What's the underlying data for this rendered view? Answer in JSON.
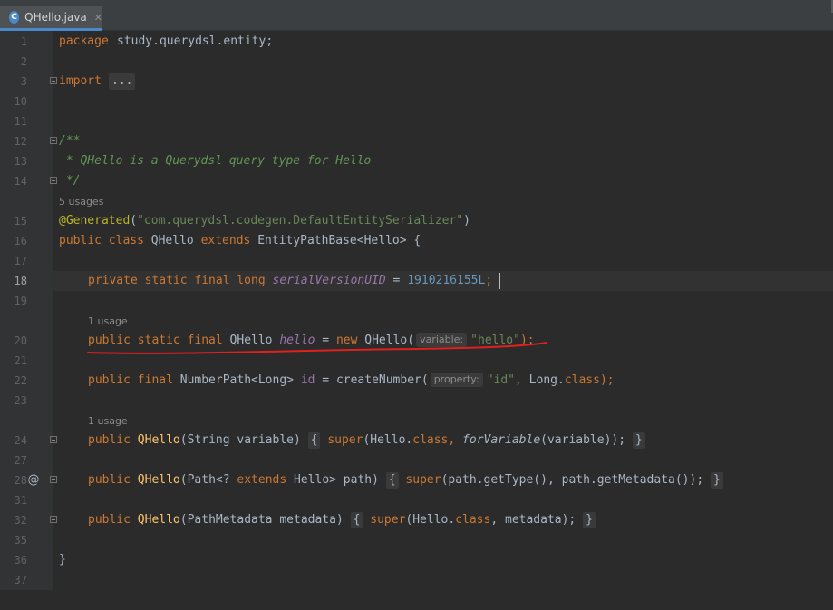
{
  "tab": {
    "filename": "QHello.java",
    "icon_letter": "C",
    "close_glyph": "✕"
  },
  "colors": {
    "keyword": "#cc7832",
    "string": "#6a8759",
    "number": "#6897bb",
    "annotation": "#bbb529",
    "comment": "#629755",
    "static_field": "#9876aa",
    "method_decl": "#ffc66d",
    "underline": "#e0201c"
  },
  "usages": {
    "class": "5 usages",
    "hello_field": "1 usage",
    "ctor1": "1 usage"
  },
  "lines": {
    "l1": {
      "num": "1",
      "package_kw": "package",
      "package_name": "study.querydsl.entity;"
    },
    "l2": {
      "num": "2"
    },
    "l3": {
      "num": "3",
      "import_kw": "import",
      "folded": "..."
    },
    "l10": {
      "num": "10"
    },
    "l11": {
      "num": "11"
    },
    "l12": {
      "num": "12",
      "text": "/**"
    },
    "l13": {
      "num": "13",
      "text": " * QHello is a Querydsl query type for Hello"
    },
    "l14": {
      "num": "14",
      "text": " */"
    },
    "l15": {
      "num": "15",
      "annotation": "@Generated",
      "open": "(",
      "value": "\"com.querydsl.codegen.DefaultEntitySerializer\"",
      "close": ")"
    },
    "l16": {
      "num": "16",
      "kw1": "public",
      "kw2": "class",
      "name": "QHello",
      "kw3": "extends",
      "base": "EntityPathBase<Hello> {"
    },
    "l17": {
      "num": "17"
    },
    "l18": {
      "num": "18",
      "kw": "private static final long",
      "field": "serialVersionUID",
      "eq": " = ",
      "value": "1910216155L",
      "semi": ";"
    },
    "l19": {
      "num": "19"
    },
    "l20": {
      "num": "20",
      "kw": "public static final",
      "type": "QHello",
      "field": "hello",
      "eq": " = ",
      "kw_new": "new",
      "call": "QHello(",
      "hint": "variable:",
      "value": "\"hello\"",
      "end": ");"
    },
    "l21": {
      "num": "21"
    },
    "l22": {
      "num": "22",
      "kw": "public final",
      "type": "NumberPath<Long>",
      "field": "id",
      "eq": " = createNumber(",
      "hint": "property:",
      "value": "\"id\"",
      "comma": ", ",
      "cls": "Long.",
      "cls_kw": "class",
      "end": ");"
    },
    "l23": {
      "num": "23"
    },
    "l24": {
      "num": "24",
      "kw": "public",
      "name": "QHello",
      "params": "(String variable)",
      "ob": "{",
      "super_kw": "super",
      "a1": "(Hello.",
      "class_kw": "class",
      "a2": ", ",
      "call": "forVariable",
      "a3": "(variable));",
      "cb": "}"
    },
    "l27": {
      "num": "27"
    },
    "l28": {
      "num": "28",
      "gutter_mark": "@",
      "kw": "public",
      "name": "QHello",
      "p1": "(Path<? ",
      "ext_kw": "extends",
      "p2": " Hello> path)",
      "ob": "{",
      "super_kw": "super",
      "a1": "(path.getType(), path.getMetadata());",
      "cb": "}"
    },
    "l31": {
      "num": "31"
    },
    "l32": {
      "num": "32",
      "kw": "public",
      "name": "QHello",
      "params": "(PathMetadata metadata)",
      "ob": "{",
      "super_kw": "super",
      "a1": "(Hello.",
      "class_kw": "class",
      "a2": ", metadata);",
      "cb": "}"
    },
    "l35": {
      "num": "35"
    },
    "l36": {
      "num": "36",
      "text": "}"
    },
    "l37": {
      "num": "37"
    }
  }
}
